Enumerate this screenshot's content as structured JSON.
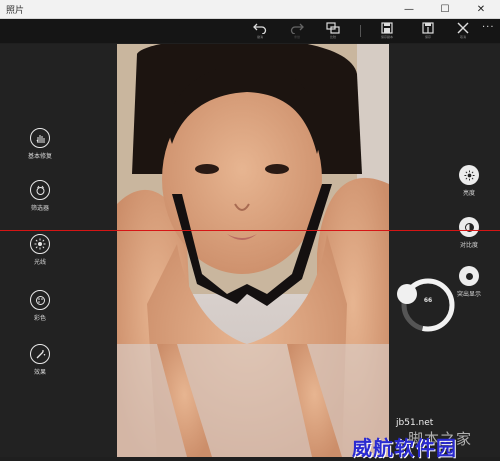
{
  "window": {
    "title": "照片",
    "minimize_icon": "—",
    "maximize_icon": "☐",
    "close_icon": "✕"
  },
  "toolbar": {
    "items": [
      {
        "icon": "undo-icon",
        "label": "撤消"
      },
      {
        "icon": "redo-icon",
        "label": "重做"
      },
      {
        "icon": "compare-icon",
        "label": "比较"
      },
      {
        "icon": "save-copy-icon",
        "label": "保存副本"
      },
      {
        "icon": "save-icon",
        "label": "保存"
      },
      {
        "icon": "cancel-icon",
        "label": "取消"
      }
    ],
    "more": "···"
  },
  "left_tools": [
    {
      "icon": "hand-icon",
      "label": "基本修复"
    },
    {
      "icon": "filter-icon",
      "label": "筛选器"
    },
    {
      "icon": "brightness-icon",
      "label": "光线"
    },
    {
      "icon": "palette-icon",
      "label": "彩色"
    },
    {
      "icon": "effects-icon",
      "label": "效果"
    }
  ],
  "right_options": [
    {
      "icon": "brightness-icon",
      "label": "亮度"
    },
    {
      "icon": "contrast-icon",
      "label": "对比度"
    },
    {
      "icon": "highlight-icon",
      "label": "突出显示"
    }
  ],
  "dial": {
    "value": "66",
    "fraction": 0.66
  },
  "watermark": {
    "url": "jb51.net",
    "site": "脚本之家",
    "brand": "威航软件园"
  }
}
